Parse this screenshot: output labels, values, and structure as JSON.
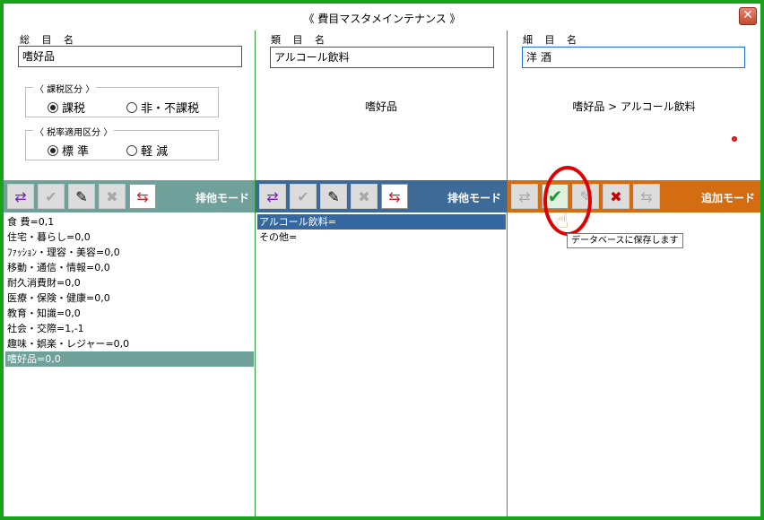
{
  "window": {
    "title": "《 費目マスタメインテナンス 》",
    "close_glyph": "✕"
  },
  "col1": {
    "label": "総 目 名",
    "value": "嗜好品",
    "tax_group": {
      "title": "〈 課税区分 〉",
      "options": [
        "課税",
        "非・不課税"
      ],
      "selected": 0
    },
    "rate_group": {
      "title": "〈 税率適用区分 〉",
      "options": [
        "標 準",
        "軽 減"
      ],
      "selected": 0
    },
    "mode": "排他モード",
    "toolbar_color": "#6fa09a",
    "items": [
      "食 費=0,1",
      "住宅・暮らし=0,0",
      "ﾌｧｯｼｮﾝ・理容・美容=0,0",
      "移動・通信・情報=0,0",
      "耐久消費財=0,0",
      "医療・保険・健康=0,0",
      "教育・知識=0,0",
      "社会・交際=1,-1",
      "趣味・娯楽・レジャー=0,0",
      "嗜好品=0,0"
    ],
    "selected_index": 9
  },
  "col2": {
    "label": "類 目 名",
    "value": "アルコール飲料",
    "path": "嗜好品",
    "mode": "排他モード",
    "toolbar_color": "#3d6a96",
    "items": [
      "アルコール飲料=",
      "その他="
    ],
    "selected_index": 0
  },
  "col3": {
    "label": "細 目 名",
    "value": "洋 酒",
    "path": "嗜好品 > アルコール飲料",
    "mode": "追加モード",
    "toolbar_color": "#d46d12",
    "tooltip": "データベースに保存します"
  },
  "icons": {
    "swap": "⇄",
    "check": "✔",
    "edit": "✎",
    "delete": "✖",
    "move": "⇆"
  }
}
